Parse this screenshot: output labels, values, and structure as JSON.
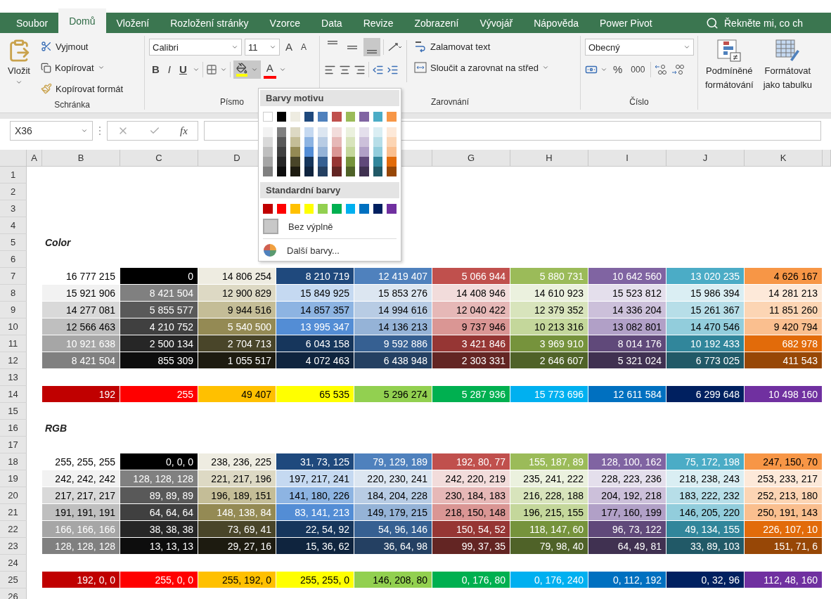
{
  "tabs": [
    {
      "label": "Soubor",
      "selected": false
    },
    {
      "label": "Domů",
      "selected": true
    },
    {
      "label": "Vložení",
      "selected": false
    },
    {
      "label": "Rozložení stránky",
      "selected": false
    },
    {
      "label": "Vzorce",
      "selected": false
    },
    {
      "label": "Data",
      "selected": false
    },
    {
      "label": "Revize",
      "selected": false
    },
    {
      "label": "Zobrazení",
      "selected": false
    },
    {
      "label": "Vývojář",
      "selected": false
    },
    {
      "label": "Nápověda",
      "selected": false
    },
    {
      "label": "Power Pivot",
      "selected": false
    }
  ],
  "tell_me": {
    "placeholder": "Řekněte mi, co ch"
  },
  "clipboard": {
    "label": "Schránka",
    "paste": "Vložit",
    "cut": "Vyjmout",
    "copy": "Kopírovat",
    "format_painter": "Kopírovat formát"
  },
  "font": {
    "label": "Písmo",
    "font_name": "Calibri",
    "font_size": "11",
    "grow": "A",
    "shrink": "A",
    "bold": "B",
    "italic": "I",
    "underline": "U",
    "font_color": "A",
    "fill_open": true
  },
  "alignment": {
    "label": "Zarovnání",
    "vertical": [
      {
        "selected": false
      },
      {
        "selected": false
      },
      {
        "selected": true
      }
    ],
    "wrap": "Zalamovat text",
    "merge": "Sloučit a zarovnat na střed"
  },
  "number": {
    "label": "Číslo",
    "format": "Obecný",
    "percent": "%",
    "thousands": "000"
  },
  "styles": [
    {
      "kind": "conditional",
      "lines": [
        "Podmíněné",
        "formátování"
      ]
    },
    {
      "kind": "table",
      "lines": [
        "Formátovat",
        "jako tabulku"
      ]
    }
  ],
  "formula_bar": {
    "name_box": "X36",
    "fx": "fx"
  },
  "columns": [
    {
      "label": "A"
    },
    {
      "label": "B"
    },
    {
      "label": "C"
    },
    {
      "label": "D"
    },
    {},
    {
      "label": "G"
    },
    {
      "label": "H"
    },
    {
      "label": "I"
    },
    {
      "label": "J"
    },
    {
      "label": "K"
    }
  ],
  "rows": [
    {
      "number": "1"
    },
    {
      "number": "2"
    },
    {
      "number": "3"
    },
    {
      "number": "4"
    },
    {
      "number": "5",
      "label": "Color"
    },
    {
      "number": "6"
    },
    {
      "number": "7",
      "cells": [
        {
          "value": "16 777 215",
          "color": "#ffffff"
        },
        {
          "value": "0",
          "color": "#000000"
        },
        {
          "value": "14 806 254",
          "color": "#eeece1"
        },
        {
          "value": "8 210 719",
          "color": "#1f497d"
        },
        {
          "value": "12 419 407",
          "color": "#4f81bd"
        },
        {
          "value": "5 066 944",
          "color": "#c0504d"
        },
        {
          "value": "5 880 731",
          "color": "#9bbb59"
        },
        {
          "value": "10 642 560",
          "color": "#8064a2"
        },
        {
          "value": "13 020 235",
          "color": "#4bacc6"
        },
        {
          "value": "4 626 167",
          "color": "#f79646"
        }
      ]
    },
    {
      "number": "8",
      "cells": [
        {
          "value": "15 921 906",
          "color": "#f2f2f2"
        },
        {
          "value": "8 421 504",
          "color": "#808080"
        },
        {
          "value": "12 900 829",
          "color": "#ddd9c4"
        },
        {
          "value": "15 849 925",
          "color": "#c5d9f1"
        },
        {
          "value": "15 853 276",
          "color": "#dce6f1"
        },
        {
          "value": "14 408 946",
          "color": "#f2dcdb"
        },
        {
          "value": "14 610 923",
          "color": "#ebf1de"
        },
        {
          "value": "15 523 812",
          "color": "#e4dfec"
        },
        {
          "value": "15 986 394",
          "color": "#daeef3"
        },
        {
          "value": "14 281 213",
          "color": "#fde9d9"
        }
      ]
    },
    {
      "number": "9",
      "cells": [
        {
          "value": "14 277 081",
          "color": "#d9d9d9"
        },
        {
          "value": "5 855 577",
          "color": "#595959"
        },
        {
          "value": "9 944 516",
          "color": "#c4bd97"
        },
        {
          "value": "14 857 357",
          "color": "#8db4e2"
        },
        {
          "value": "14 994 616",
          "color": "#b8cce4"
        },
        {
          "value": "12 040 422",
          "color": "#e6b8b7"
        },
        {
          "value": "12 379 352",
          "color": "#d8e4bc"
        },
        {
          "value": "14 336 204",
          "color": "#ccc0da"
        },
        {
          "value": "15 261 367",
          "color": "#b7dee8"
        },
        {
          "value": "11 851 260",
          "color": "#fcd5b4"
        }
      ]
    },
    {
      "number": "10",
      "cells": [
        {
          "value": "12 566 463",
          "color": "#bfbfbf"
        },
        {
          "value": "4 210 752",
          "color": "#404040"
        },
        {
          "value": "5 540 500",
          "color": "#948a54"
        },
        {
          "value": "13 995 347",
          "color": "#538dd5"
        },
        {
          "value": "14 136 213",
          "color": "#95b3d7"
        },
        {
          "value": "9 737 946",
          "color": "#da9694"
        },
        {
          "value": "10 213 316",
          "color": "#c4d79b"
        },
        {
          "value": "13 082 801",
          "color": "#b1a0c7"
        },
        {
          "value": "14 470 546",
          "color": "#92cddc"
        },
        {
          "value": "9 420 794",
          "color": "#fabf8f"
        }
      ]
    },
    {
      "number": "11",
      "cells": [
        {
          "value": "10 921 638",
          "color": "#a6a6a6"
        },
        {
          "value": "2 500 134",
          "color": "#262626"
        },
        {
          "value": "2 704 713",
          "color": "#494529"
        },
        {
          "value": "6 043 158",
          "color": "#16365c"
        },
        {
          "value": "9 592 886",
          "color": "#366092"
        },
        {
          "value": "3 421 846",
          "color": "#963634"
        },
        {
          "value": "3 969 910",
          "color": "#76933c"
        },
        {
          "value": "8 014 176",
          "color": "#60497a"
        },
        {
          "value": "10 192 433",
          "color": "#31869b"
        },
        {
          "value": "682 978",
          "color": "#e26b0a"
        }
      ]
    },
    {
      "number": "12",
      "cells": [
        {
          "value": "8 421 504",
          "color": "#808080"
        },
        {
          "value": "855 309",
          "color": "#0d0d0d"
        },
        {
          "value": "1 055 517",
          "color": "#1d1b10"
        },
        {
          "value": "4 072 463",
          "color": "#0f243e"
        },
        {
          "value": "6 438 948",
          "color": "#244062"
        },
        {
          "value": "2 303 331",
          "color": "#632523"
        },
        {
          "value": "2 646 607",
          "color": "#4f6228"
        },
        {
          "value": "5 321 024",
          "color": "#403151"
        },
        {
          "value": "6 773 025",
          "color": "#215967"
        },
        {
          "value": "411 543",
          "color": "#974706"
        }
      ]
    },
    {
      "number": "13"
    },
    {
      "number": "14",
      "cells": [
        {
          "value": "192",
          "color": "#c00000"
        },
        {
          "value": "255",
          "color": "#ff0000"
        },
        {
          "value": "49 407",
          "color": "#ffc000"
        },
        {
          "value": "65 535",
          "color": "#ffff00"
        },
        {
          "value": "5 296 274",
          "color": "#92d050"
        },
        {
          "value": "5 287 936",
          "color": "#00b050"
        },
        {
          "value": "15 773 696",
          "color": "#00b0f0"
        },
        {
          "value": "12 611 584",
          "color": "#0070c0"
        },
        {
          "value": "6 299 648",
          "color": "#002060"
        },
        {
          "value": "10 498 160",
          "color": "#7030a0"
        }
      ]
    },
    {
      "number": "15"
    },
    {
      "number": "16",
      "label": "RGB"
    },
    {
      "number": "17"
    },
    {
      "number": "18",
      "cells": [
        {
          "value": "255, 255, 255",
          "color": "#ffffff"
        },
        {
          "value": "0, 0, 0",
          "color": "#000000"
        },
        {
          "value": "238, 236, 225",
          "color": "#eeece1"
        },
        {
          "value": "31, 73, 125",
          "color": "#1f497d"
        },
        {
          "value": "79, 129, 189",
          "color": "#4f81bd"
        },
        {
          "value": "192, 80, 77",
          "color": "#c0504d"
        },
        {
          "value": "155, 187, 89",
          "color": "#9bbb59"
        },
        {
          "value": "128, 100, 162",
          "color": "#8064a2"
        },
        {
          "value": "75, 172, 198",
          "color": "#4bacc6"
        },
        {
          "value": "247, 150, 70",
          "color": "#f79646"
        }
      ]
    },
    {
      "number": "19",
      "cells": [
        {
          "value": "242, 242, 242",
          "color": "#f2f2f2"
        },
        {
          "value": "128, 128, 128",
          "color": "#808080"
        },
        {
          "value": "221, 217, 196",
          "color": "#ddd9c4"
        },
        {
          "value": "197, 217, 241",
          "color": "#c5d9f1"
        },
        {
          "value": "220, 230, 241",
          "color": "#dce6f1"
        },
        {
          "value": "242, 220, 219",
          "color": "#f2dcdb"
        },
        {
          "value": "235, 241, 222",
          "color": "#ebf1de"
        },
        {
          "value": "228, 223, 236",
          "color": "#e4dfec"
        },
        {
          "value": "218, 238, 243",
          "color": "#daeef3"
        },
        {
          "value": "253, 233, 217",
          "color": "#fde9d9"
        }
      ]
    },
    {
      "number": "20",
      "cells": [
        {
          "value": "217, 217, 217",
          "color": "#d9d9d9"
        },
        {
          "value": "89, 89, 89",
          "color": "#595959"
        },
        {
          "value": "196, 189, 151",
          "color": "#c4bd97"
        },
        {
          "value": "141, 180, 226",
          "color": "#8db4e2"
        },
        {
          "value": "184, 204, 228",
          "color": "#b8cce4"
        },
        {
          "value": "230, 184, 183",
          "color": "#e6b8b7"
        },
        {
          "value": "216, 228, 188",
          "color": "#d8e4bc"
        },
        {
          "value": "204, 192, 218",
          "color": "#ccc0da"
        },
        {
          "value": "183, 222, 232",
          "color": "#b7dee8"
        },
        {
          "value": "252, 213, 180",
          "color": "#fcd5b4"
        }
      ]
    },
    {
      "number": "21",
      "cells": [
        {
          "value": "191, 191, 191",
          "color": "#bfbfbf"
        },
        {
          "value": "64, 64, 64",
          "color": "#404040"
        },
        {
          "value": "148, 138, 84",
          "color": "#948a54"
        },
        {
          "value": "83, 141, 213",
          "color": "#538dd5"
        },
        {
          "value": "149, 179, 215",
          "color": "#95b3d7"
        },
        {
          "value": "218, 150, 148",
          "color": "#da9694"
        },
        {
          "value": "196, 215, 155",
          "color": "#c4d79b"
        },
        {
          "value": "177, 160, 199",
          "color": "#b1a0c7"
        },
        {
          "value": "146, 205, 220",
          "color": "#92cddc"
        },
        {
          "value": "250, 191, 143",
          "color": "#fabf8f"
        }
      ]
    },
    {
      "number": "22",
      "cells": [
        {
          "value": "166, 166, 166",
          "color": "#a6a6a6"
        },
        {
          "value": "38, 38, 38",
          "color": "#262626"
        },
        {
          "value": "73, 69, 41",
          "color": "#494529"
        },
        {
          "value": "22, 54, 92",
          "color": "#16365c"
        },
        {
          "value": "54, 96, 146",
          "color": "#366092"
        },
        {
          "value": "150, 54, 52",
          "color": "#963634"
        },
        {
          "value": "118, 147, 60",
          "color": "#76933c"
        },
        {
          "value": "96, 73, 122",
          "color": "#60497a"
        },
        {
          "value": "49, 134, 155",
          "color": "#31869b"
        },
        {
          "value": "226, 107, 10",
          "color": "#e26b0a"
        }
      ]
    },
    {
      "number": "23",
      "cells": [
        {
          "value": "128, 128, 128",
          "color": "#808080"
        },
        {
          "value": "13, 13, 13",
          "color": "#0d0d0d"
        },
        {
          "value": "29, 27, 16",
          "color": "#1d1b10"
        },
        {
          "value": "15, 36, 62",
          "color": "#0f243e"
        },
        {
          "value": "36, 64, 98",
          "color": "#244062"
        },
        {
          "value": "99, 37, 35",
          "color": "#632523"
        },
        {
          "value": "79, 98, 40",
          "color": "#4f6228"
        },
        {
          "value": "64, 49, 81",
          "color": "#403151"
        },
        {
          "value": "33, 89, 103",
          "color": "#215967"
        },
        {
          "value": "151, 71, 6",
          "color": "#974706"
        }
      ]
    },
    {
      "number": "24"
    },
    {
      "number": "25",
      "cells": [
        {
          "value": "192, 0, 0",
          "color": "#c00000"
        },
        {
          "value": "255, 0, 0",
          "color": "#ff0000"
        },
        {
          "value": "255, 192, 0",
          "color": "#ffc000"
        },
        {
          "value": "255, 255, 0",
          "color": "#ffff00"
        },
        {
          "value": "146, 208, 80",
          "color": "#92d050"
        },
        {
          "value": "0, 176, 80",
          "color": "#00b050"
        },
        {
          "value": "0, 176, 240",
          "color": "#00b0f0"
        },
        {
          "value": "0, 112, 192",
          "color": "#0070c0"
        },
        {
          "value": "0, 32, 96",
          "color": "#002060"
        },
        {
          "value": "112, 48, 160",
          "color": "#7030a0"
        }
      ]
    },
    {
      "number": "26"
    }
  ],
  "fill_menu": {
    "theme_title": "Barvy motivu",
    "theme_rows": [
      {
        "swatches": [
          {
            "color": "#ffffff"
          },
          {
            "color": "#000000"
          },
          {
            "color": "#eeece1"
          },
          {
            "color": "#1f497d"
          },
          {
            "color": "#4f81bd"
          },
          {
            "color": "#c0504d"
          },
          {
            "color": "#9bbb59"
          },
          {
            "color": "#8064a2"
          },
          {
            "color": "#4bacc6"
          },
          {
            "color": "#f79646"
          }
        ]
      },
      {
        "swatches": [
          {
            "color": "#f2f2f2"
          },
          {
            "color": "#808080"
          },
          {
            "color": "#ddd9c4"
          },
          {
            "color": "#c5d9f1"
          },
          {
            "color": "#dce6f1"
          },
          {
            "color": "#f2dcdb"
          },
          {
            "color": "#ebf1de"
          },
          {
            "color": "#e4dfec"
          },
          {
            "color": "#daeef3"
          },
          {
            "color": "#fde9d9"
          }
        ]
      },
      {
        "swatches": [
          {
            "color": "#d9d9d9"
          },
          {
            "color": "#595959"
          },
          {
            "color": "#c4bd97"
          },
          {
            "color": "#8db4e2"
          },
          {
            "color": "#b8cce4"
          },
          {
            "color": "#e6b8b7"
          },
          {
            "color": "#d8e4bc"
          },
          {
            "color": "#ccc0da"
          },
          {
            "color": "#b7dee8"
          },
          {
            "color": "#fcd5b4"
          }
        ]
      },
      {
        "swatches": [
          {
            "color": "#bfbfbf"
          },
          {
            "color": "#404040"
          },
          {
            "color": "#948a54"
          },
          {
            "color": "#538dd5"
          },
          {
            "color": "#95b3d7"
          },
          {
            "color": "#da9694"
          },
          {
            "color": "#c4d79b"
          },
          {
            "color": "#b1a0c7"
          },
          {
            "color": "#92cddc"
          },
          {
            "color": "#fabf8f"
          }
        ]
      },
      {
        "swatches": [
          {
            "color": "#a6a6a6"
          },
          {
            "color": "#262626"
          },
          {
            "color": "#494529"
          },
          {
            "color": "#16365c"
          },
          {
            "color": "#366092"
          },
          {
            "color": "#963634"
          },
          {
            "color": "#76933c"
          },
          {
            "color": "#60497a"
          },
          {
            "color": "#31869b"
          },
          {
            "color": "#e26b0a"
          }
        ]
      },
      {
        "swatches": [
          {
            "color": "#808080"
          },
          {
            "color": "#0d0d0d"
          },
          {
            "color": "#1d1b10"
          },
          {
            "color": "#0f243e"
          },
          {
            "color": "#244062"
          },
          {
            "color": "#632523"
          },
          {
            "color": "#4f6228"
          },
          {
            "color": "#403151"
          },
          {
            "color": "#215967"
          },
          {
            "color": "#974706"
          }
        ]
      }
    ],
    "standard_title": "Standardní barvy",
    "standard": [
      {
        "color": "#c00000"
      },
      {
        "color": "#ff0000"
      },
      {
        "color": "#ffc000"
      },
      {
        "color": "#ffff00"
      },
      {
        "color": "#92d050"
      },
      {
        "color": "#00b050"
      },
      {
        "color": "#00b0f0"
      },
      {
        "color": "#0070c0"
      },
      {
        "color": "#002060"
      },
      {
        "color": "#7030a0"
      }
    ],
    "no_fill": "Bez výplně",
    "more_colors": "Další barvy..."
  }
}
